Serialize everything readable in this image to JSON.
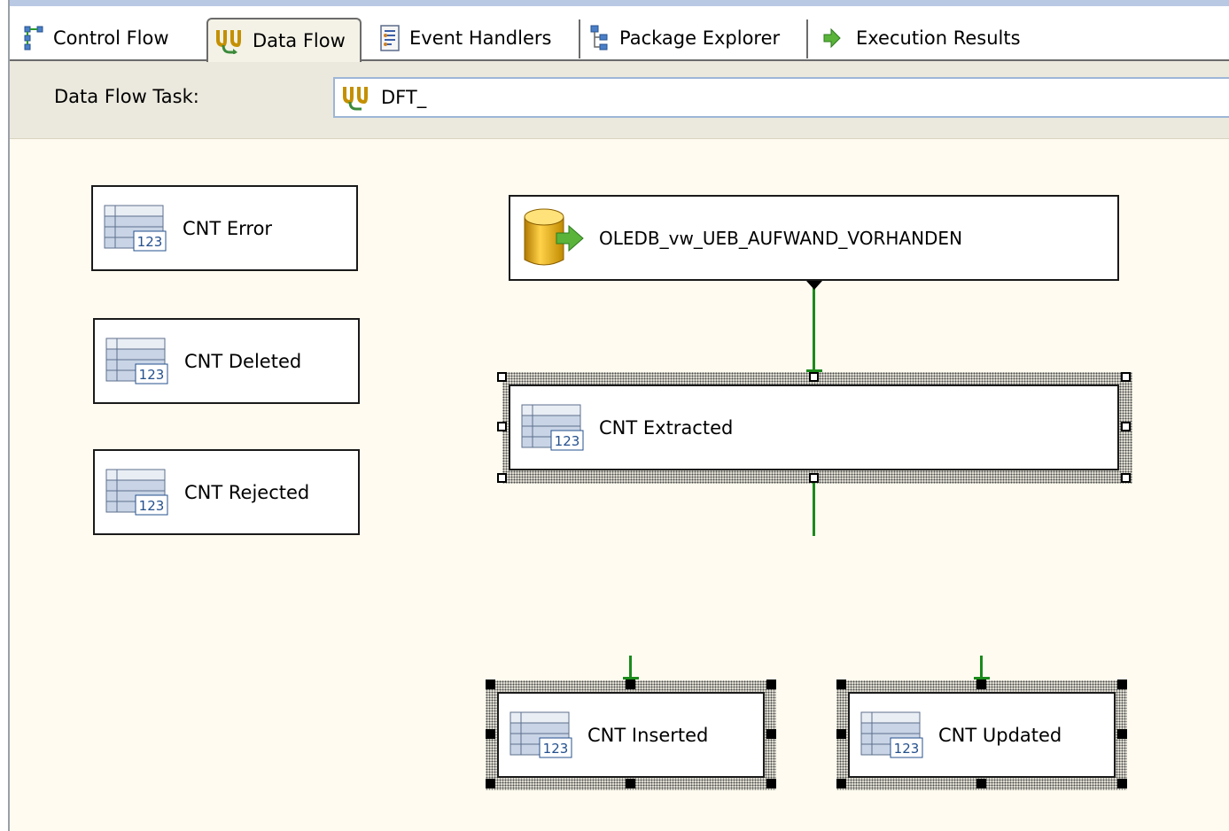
{
  "tabs": [
    {
      "label": "Control Flow",
      "icon": "control-flow-icon"
    },
    {
      "label": "Data Flow",
      "icon": "data-flow-icon",
      "active": true
    },
    {
      "label": "Event Handlers",
      "icon": "event-handlers-icon"
    },
    {
      "label": "Package Explorer",
      "icon": "package-explorer-icon"
    },
    {
      "label": "Execution Results",
      "icon": "execution-results-icon"
    }
  ],
  "task": {
    "label": "Data Flow Task:",
    "value": "DFT_"
  },
  "components": {
    "source": "OLEDB_vw_UEB_AUFWAND_VORHANDEN",
    "error": "CNT Error",
    "deleted": "CNT Deleted",
    "rejected": "CNT Rejected",
    "extracted": "CNT Extracted",
    "inserted": "CNT Inserted",
    "updated": "CNT Updated"
  },
  "colors": {
    "canvas": "#fffbf0",
    "path": "#1b8a1b",
    "toolbar": "#ebe9dd"
  }
}
